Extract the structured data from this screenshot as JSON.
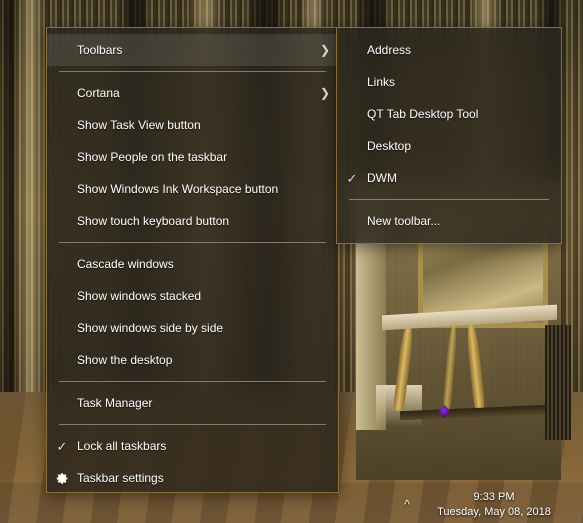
{
  "desktop": {
    "wallpaper_description": "ornate palace interior with gilded columns, mirror and console table",
    "cursor_icon": "diamond-cursor-icon"
  },
  "taskbar": {
    "tray_chevron_icon": "chevron-up-icon",
    "clock": {
      "time": "9:33 PM",
      "date": "Tuesday, May 08, 2018"
    }
  },
  "context_menu": {
    "name": "taskbar-context-menu",
    "groups": [
      {
        "items": [
          {
            "label": "Toolbars",
            "submenu": true,
            "arrow_icon": "chevron-right-icon",
            "highlighted": true,
            "check": false
          }
        ]
      },
      {
        "items": [
          {
            "label": "Cortana",
            "submenu": true,
            "arrow_icon": "chevron-right-icon",
            "highlighted": false,
            "check": false
          },
          {
            "label": "Show Task View button",
            "submenu": false,
            "check": false
          },
          {
            "label": "Show People on the taskbar",
            "submenu": false,
            "check": false
          },
          {
            "label": "Show Windows Ink Workspace button",
            "submenu": false,
            "check": false
          },
          {
            "label": "Show touch keyboard button",
            "submenu": false,
            "check": false
          }
        ]
      },
      {
        "items": [
          {
            "label": "Cascade windows",
            "submenu": false,
            "check": false
          },
          {
            "label": "Show windows stacked",
            "submenu": false,
            "check": false
          },
          {
            "label": "Show windows side by side",
            "submenu": false,
            "check": false
          },
          {
            "label": "Show the desktop",
            "submenu": false,
            "check": false
          }
        ]
      },
      {
        "items": [
          {
            "label": "Task Manager",
            "submenu": false,
            "check": false
          }
        ]
      },
      {
        "items": [
          {
            "label": "Lock all taskbars",
            "submenu": false,
            "check": true,
            "check_icon": "checkmark-icon"
          },
          {
            "label": "Taskbar settings",
            "submenu": false,
            "check": false,
            "icon": "gear-icon"
          }
        ]
      }
    ]
  },
  "toolbars_submenu": {
    "name": "toolbars-submenu",
    "groups": [
      {
        "items": [
          {
            "label": "Address",
            "check": false
          },
          {
            "label": "Links",
            "check": false
          },
          {
            "label": "QT Tab Desktop Tool",
            "check": false
          },
          {
            "label": "Desktop",
            "check": false
          },
          {
            "label": "DWM",
            "check": true,
            "check_icon": "checkmark-icon"
          }
        ]
      },
      {
        "items": [
          {
            "label": "New toolbar...",
            "check": false
          }
        ]
      }
    ]
  },
  "colors": {
    "menu_background": "#282420",
    "menu_border": "#8a6f3d",
    "menu_text": "#ffffff",
    "check_color": "#cfe3f5",
    "arrow_color": "#e6dcc4",
    "separator": "#e4decе",
    "clock_text": "#ffffff"
  }
}
